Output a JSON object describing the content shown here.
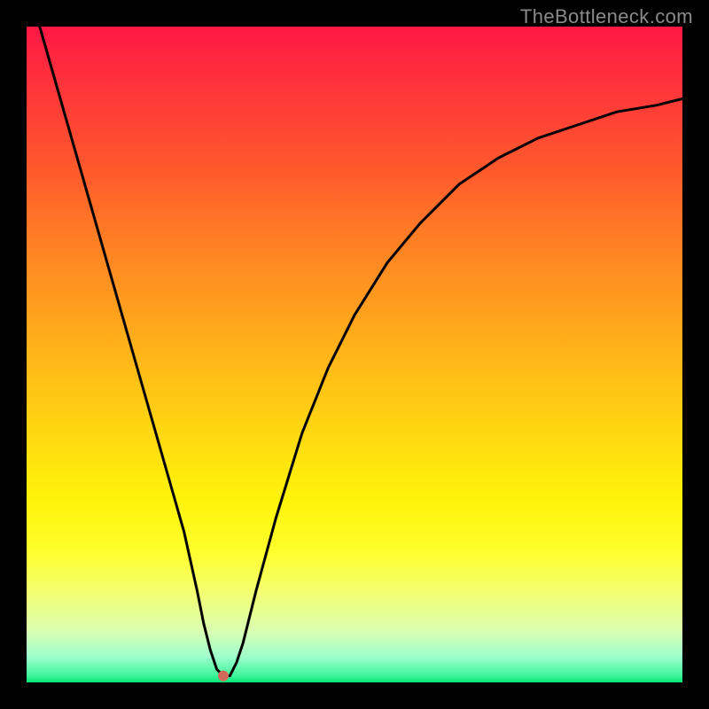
{
  "watermark": "TheBottleneck.com",
  "colors": {
    "background": "#000000",
    "gradient_top": "#ff1744",
    "gradient_mid_upper": "#ff9c1e",
    "gradient_mid": "#fff30a",
    "gradient_lower": "#a0ffce",
    "gradient_bottom": "#00e676",
    "curve_stroke": "#000000",
    "marker_fill": "#d26a5c"
  },
  "chart_data": {
    "type": "line",
    "title": "",
    "xlabel": "",
    "ylabel": "",
    "xlim": [
      0,
      100
    ],
    "ylim": [
      0,
      100
    ],
    "grid": false,
    "legend": false,
    "series": [
      {
        "name": "bottleneck-curve",
        "x": [
          2,
          4,
          6,
          8,
          10,
          12,
          14,
          16,
          18,
          20,
          22,
          24,
          26,
          27,
          28,
          29,
          30,
          31,
          32,
          33,
          35,
          38,
          42,
          46,
          50,
          55,
          60,
          66,
          72,
          78,
          84,
          90,
          96,
          100
        ],
        "values": [
          100,
          93,
          86,
          79,
          72,
          65,
          58,
          51,
          44,
          37,
          30,
          23,
          14,
          9,
          5,
          2,
          1,
          1,
          3,
          6,
          14,
          25,
          38,
          48,
          56,
          64,
          70,
          76,
          80,
          83,
          85,
          87,
          88,
          89
        ]
      }
    ],
    "marker": {
      "x": 30,
      "y": 1
    },
    "annotations": []
  }
}
